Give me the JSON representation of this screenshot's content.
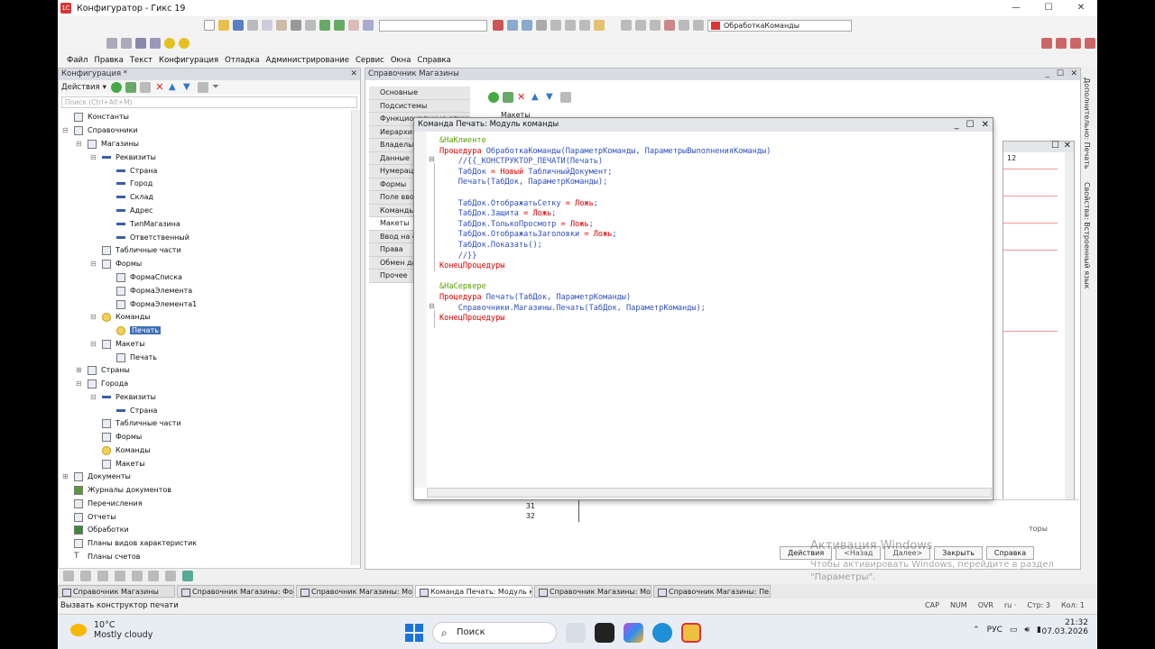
{
  "window": {
    "title": "Конфигуратор - Гикс 19",
    "min": "—",
    "max": "☐",
    "close": "✕"
  },
  "toolbar": {
    "object_select": "ОбработкаКоманды"
  },
  "menu": [
    "Файл",
    "Правка",
    "Текст",
    "Конфигурация",
    "Отладка",
    "Администрирование",
    "Сервис",
    "Окна",
    "Справка"
  ],
  "config_panel": {
    "title": "Конфигурация *",
    "actions_label": "Действия",
    "search_placeholder": "Поиск (Ctrl+Alt+M)",
    "tree": [
      "Константы",
      "Справочники",
      "Магазины",
      "Реквизиты",
      "Страна",
      "Город",
      "Склад",
      "Адрес",
      "ТипМагазина",
      "Ответственный",
      "Табличные части",
      "Формы",
      "ФормаСписка",
      "ФормаЭлемента",
      "ФормаЭлемента1",
      "Команды",
      "Печать",
      "Макеты",
      "Печать",
      "Страны",
      "Города",
      "Реквизиты",
      "Страна",
      "Табличные части",
      "Формы",
      "Команды",
      "Макеты",
      "Документы",
      "Журналы документов",
      "Перечисления",
      "Отчеты",
      "Обработки",
      "Планы видов характеристик",
      "Планы счетов"
    ]
  },
  "catalog_window": {
    "title": "Справочник Магазины",
    "tabs": [
      "Основные",
      "Подсистемы",
      "Функциональные опции",
      "Иерархия",
      "Владельцы",
      "Данные",
      "Нумерация",
      "Формы",
      "Поле ввода",
      "Команды",
      "Макеты",
      "Ввод на основании",
      "Права",
      "Обмен данными",
      "Прочее"
    ],
    "grid_header": "Макеты",
    "row_num_12": "12",
    "row_31": "31",
    "row_32": "32",
    "right_label": "торы"
  },
  "module_window": {
    "title": "Команда Печать: Модуль команды",
    "code": [
      [
        [
          "ds",
          "&НаКлиенте"
        ]
      ],
      [
        [
          "kw",
          "Процедура"
        ],
        [
          "id",
          " ОбработкаКоманды(ПараметрКоманды, ПараметрыВыполненияКоманды)"
        ]
      ],
      [
        [
          "id",
          "    //{{_КОНСТРУКТОР_ПЕЧАТИ(Печать)"
        ]
      ],
      [
        [
          "id",
          "    ТабДок "
        ],
        [
          "kw",
          "= Новый"
        ],
        [
          "id",
          " ТабличныйДокумент;"
        ]
      ],
      [
        [
          "id",
          "    Печать(ТабДок, ПараметрКоманды);"
        ]
      ],
      [
        [
          "id",
          ""
        ]
      ],
      [
        [
          "id",
          "    ТабДок.ОтображатьСетку "
        ],
        [
          "kw",
          "= Ложь"
        ],
        [
          "id",
          ";"
        ]
      ],
      [
        [
          "id",
          "    ТабДок.Защита "
        ],
        [
          "kw",
          "= Ложь"
        ],
        [
          "id",
          ";"
        ]
      ],
      [
        [
          "id",
          "    ТабДок.ТолькоПросмотр "
        ],
        [
          "kw",
          "= Ложь"
        ],
        [
          "id",
          ";"
        ]
      ],
      [
        [
          "id",
          "    ТабДок.ОтображатьЗаголовки "
        ],
        [
          "kw",
          "= Ложь"
        ],
        [
          "id",
          ";"
        ]
      ],
      [
        [
          "id",
          "    ТабДок.Показать();"
        ]
      ],
      [
        [
          "id",
          "    //}}"
        ]
      ],
      [
        [
          "kw",
          "КонецПроцедуры"
        ]
      ],
      [
        [
          "id",
          ""
        ]
      ],
      [
        [
          "ds",
          "&НаСервере"
        ]
      ],
      [
        [
          "kw",
          "Процедура"
        ],
        [
          "id",
          " Печать(ТабДок, ПараметрКоманды)"
        ]
      ],
      [
        [
          "id",
          "    Справочники.Магазины.Печать(ТабДок, ПараметрКоманды);"
        ]
      ],
      [
        [
          "kw",
          "КонецПроцедуры"
        ]
      ]
    ]
  },
  "right_sidebar": {
    "tab1": "Дополнительно: Печать",
    "tab2": "Свойства: Встроенный язык"
  },
  "bottom_buttons": {
    "actions": "Действия",
    "back": "<Назад",
    "next": "Далее>",
    "close": "Закрыть",
    "help": "Справка"
  },
  "watermark": {
    "line1": "Активация Windows",
    "line2": "Чтобы активировать Windows, перейдите в раздел",
    "line3": "\"Параметры\"."
  },
  "window_tabs": [
    "Справочник Магазины",
    "Справочник Магазины: Фо...",
    "Справочник Магазины: Мо...",
    "Команда Печать: Модуль к...",
    "Справочник Магазины: Мо...",
    "Справочник Магазины: Пе..."
  ],
  "status": {
    "text": "Вызвать конструктор печати",
    "cap": "CAP",
    "num": "NUM",
    "ovr": "OVR",
    "lang": "ru ·",
    "line": "Стр: 3",
    "col": "Кол: 1"
  },
  "taskbar": {
    "temp": "10°C",
    "weather": "Mostly cloudy",
    "search": "Поиск",
    "lang": "РУС",
    "time": "21:32",
    "date": "07.03.2026"
  },
  "colors": {
    "keyword": "#e00000",
    "directive": "#5aa000",
    "identifier": "#3050c0",
    "selection": "#3d6fb6"
  }
}
